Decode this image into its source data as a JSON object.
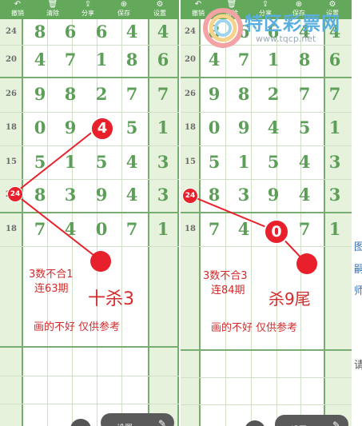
{
  "toolbar": {
    "left": [
      {
        "icon": "↶",
        "label": "撤销"
      },
      {
        "icon": "🗑",
        "label": "清除"
      },
      {
        "icon": "⇪",
        "label": "分享"
      },
      {
        "icon": "⊕",
        "label": "保存"
      },
      {
        "icon": "⚙",
        "label": "设置"
      }
    ],
    "right": [
      {
        "icon": "↶",
        "label": "撤销"
      },
      {
        "icon": "🗑",
        "label": "清除"
      },
      {
        "icon": "⇪",
        "label": "分享"
      },
      {
        "icon": "⊕",
        "label": "保存"
      },
      {
        "icon": "⚙",
        "label": "设置"
      }
    ]
  },
  "grid_left": {
    "rows": [
      {
        "label": "24",
        "digits": [
          "8",
          "6",
          "6",
          "4",
          "4"
        ]
      },
      {
        "label": "20",
        "digits": [
          "4",
          "7",
          "1",
          "8",
          "6"
        ]
      },
      {
        "label": "26",
        "digits": [
          "9",
          "8",
          "2",
          "7",
          "7"
        ]
      },
      {
        "label": "18",
        "digits": [
          "0",
          "9",
          "4",
          "5",
          "1"
        ]
      },
      {
        "label": "15",
        "digits": [
          "5",
          "1",
          "5",
          "4",
          "3"
        ]
      },
      {
        "label": "24",
        "digits": [
          "8",
          "3",
          "9",
          "4",
          "3"
        ]
      },
      {
        "label": "18",
        "digits": [
          "7",
          "4",
          "0",
          "7",
          "1"
        ]
      }
    ]
  },
  "grid_right": {
    "rows": [
      {
        "label": "24",
        "digits": [
          "8",
          "6",
          "6",
          "4",
          "4"
        ]
      },
      {
        "label": "20",
        "digits": [
          "4",
          "7",
          "1",
          "8",
          "6"
        ]
      },
      {
        "label": "26",
        "digits": [
          "9",
          "8",
          "2",
          "7",
          "7"
        ]
      },
      {
        "label": "18",
        "digits": [
          "0",
          "9",
          "4",
          "5",
          "1"
        ]
      },
      {
        "label": "15",
        "digits": [
          "5",
          "1",
          "5",
          "4",
          "3"
        ]
      },
      {
        "label": "24",
        "digits": [
          "8",
          "3",
          "9",
          "4",
          "3"
        ]
      },
      {
        "label": "18",
        "digits": [
          "7",
          "4",
          "0",
          "7",
          "1"
        ]
      }
    ]
  },
  "annotations": {
    "left": {
      "marker_big": "4",
      "marker_small": "24",
      "note_line1": "3数不合1",
      "note_line2": "连63期",
      "headline": "十杀3",
      "disclaimer": "画的不好  仅供参考"
    },
    "right": {
      "marker_big": "0",
      "marker_small": "24",
      "note_line1": "3数不合3",
      "note_line2": "连84期",
      "headline": "杀9尾",
      "disclaimer": "画的不好  仅供参考"
    }
  },
  "bottom_bar": {
    "left_label": "设置",
    "right_label": "设置"
  },
  "watermark": {
    "name": "特区彩票网",
    "url": "www.tqcp.net"
  },
  "edge_glyphs": [
    "图",
    "嗣",
    "师",
    "请"
  ],
  "colors": {
    "toolbar": "#64a85c",
    "digit": "#5d9f58",
    "column_fill": "#e6f2db",
    "marker": "#e8202b",
    "note": "#d42a2a"
  }
}
